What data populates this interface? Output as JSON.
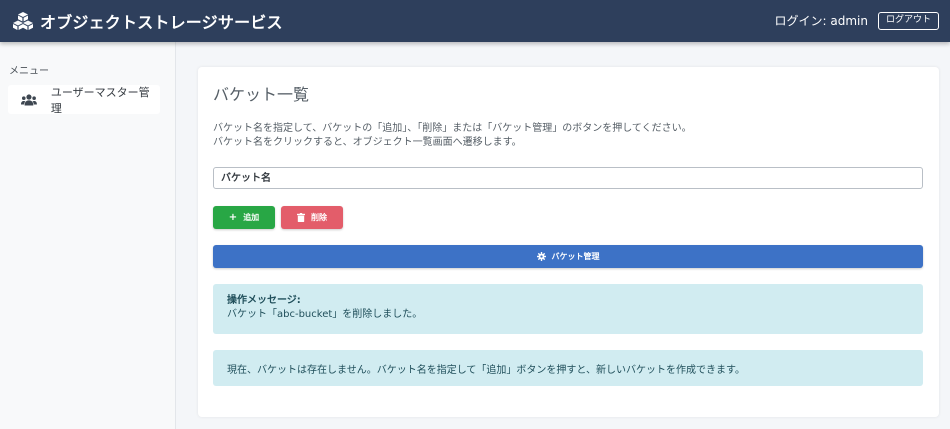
{
  "header": {
    "title": "オブジェクトストレージサービス",
    "login_text": "ログイン: admin",
    "logout_label": "ログアウト",
    "background_color": "#2e3f5c"
  },
  "sidebar": {
    "menu_label": "メニュー",
    "items": [
      {
        "label": "ユーザーマスター管理",
        "icon": "users-icon"
      }
    ]
  },
  "main": {
    "title": "バケット一覧",
    "description_line1": "バケット名を指定して、バケットの「追加」、「削除」または「バケット管理」のボタンを押してください。",
    "description_line2": "バケット名をクリックすると、オブジェクト一覧画面へ遷移します。",
    "bucket_input": {
      "placeholder": "バケット名",
      "value": ""
    },
    "buttons": {
      "add_label": "追加",
      "delete_label": "削除",
      "manage_label": "バケット管理"
    },
    "alert_message": {
      "title": "操作メッセージ:",
      "text": "バケット「abc-bucket」を削除しました。"
    },
    "info_message": "現在、バケットは存在しません。バケット名を指定して「追加」ボタンを押すと、新しいバケットを作成できます。"
  },
  "colors": {
    "add": "#28a745",
    "delete": "#e35d6a",
    "manage": "#3d72c6",
    "alert_bg": "#d1ecf1"
  }
}
